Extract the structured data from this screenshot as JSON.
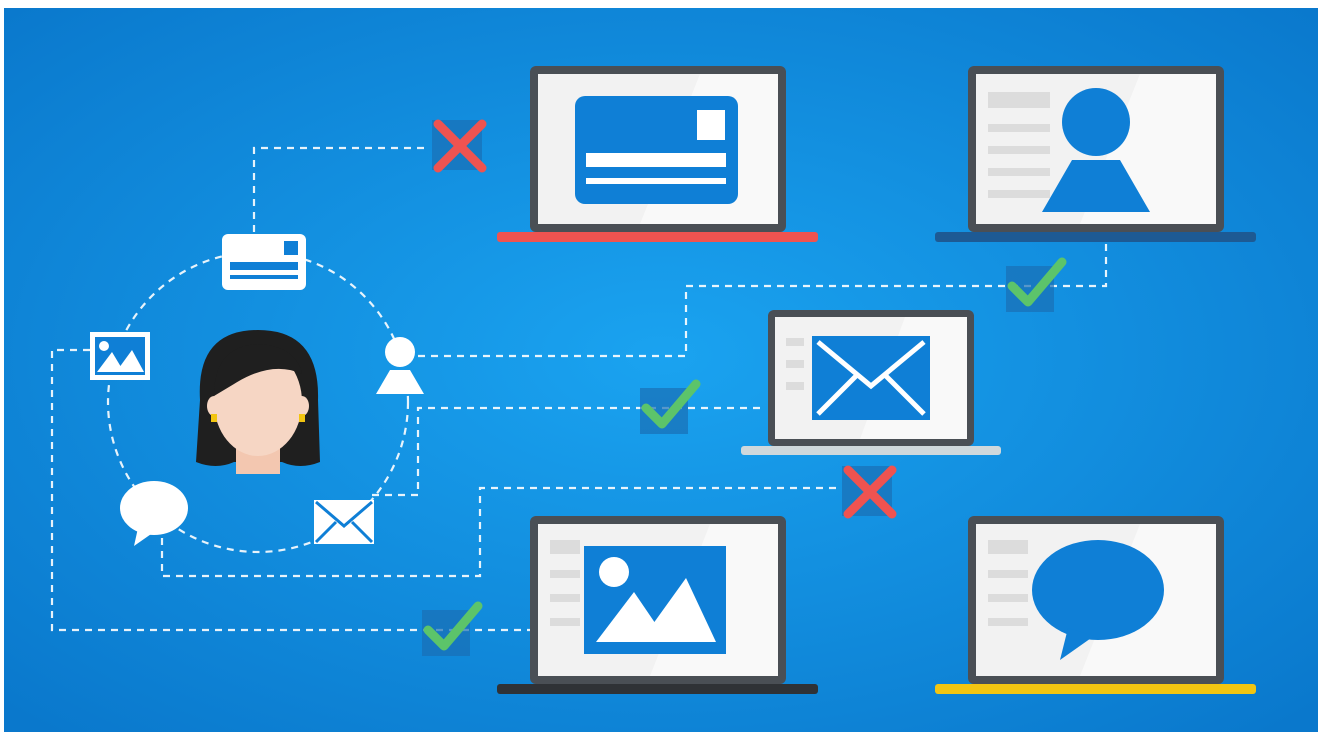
{
  "scene": {
    "description_colors": {
      "background_center": "#1aa3f0",
      "background_edge": "#0a78cc",
      "frame_white": "#ffffff",
      "screen_white": "#f2f2f2",
      "laptop_frame": "#4a4f55",
      "accent_blue": "#0f7fd6",
      "check_green": "#5cc46a",
      "cross_red": "#ef5350",
      "base_red": "#ef5350",
      "base_navy": "#1d5a94",
      "base_light": "#cfd8dc",
      "base_dark": "#2f3236",
      "base_yellow": "#f2c511",
      "skin": "#f6d6c4",
      "hair": "#1f1f1f"
    },
    "laptops": [
      {
        "id": "card-laptop",
        "icon": "credit-card-icon",
        "base_color": "#ef5350",
        "status": "denied"
      },
      {
        "id": "profile-laptop",
        "icon": "user-profile-icon",
        "base_color": "#1d5a94",
        "status": "allowed"
      },
      {
        "id": "mail-laptop",
        "icon": "envelope-icon",
        "base_color": "#cfd8dc",
        "status": "allowed"
      },
      {
        "id": "image-laptop",
        "icon": "image-icon",
        "base_color": "#2f3236",
        "status": "allowed"
      },
      {
        "id": "chat-laptop",
        "icon": "chat-bubble-icon",
        "base_color": "#f2c511",
        "status": "denied"
      }
    ],
    "orbit_icons": [
      "id-card-icon",
      "photo-icon",
      "person-icon",
      "chat-icon",
      "mail-icon"
    ],
    "status_marks": [
      {
        "icon": "cross-icon",
        "for": "card-laptop"
      },
      {
        "icon": "check-icon",
        "for": "profile-laptop"
      },
      {
        "icon": "check-icon",
        "for": "mail-laptop"
      },
      {
        "icon": "cross-icon",
        "for": "chat-laptop"
      },
      {
        "icon": "check-icon",
        "for": "image-laptop"
      }
    ]
  }
}
